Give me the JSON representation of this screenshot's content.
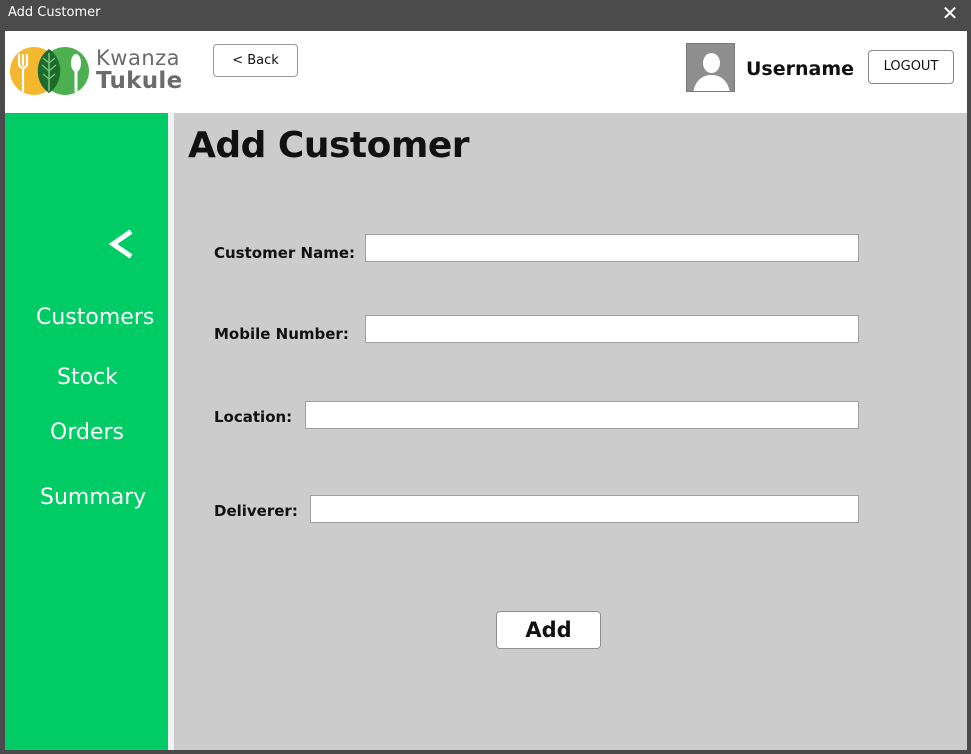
{
  "window": {
    "title": "Add Customer",
    "close_glyph": "✕"
  },
  "header": {
    "brand_line1": "Kwanza",
    "brand_line2": "Tukule",
    "back_label": "< Back",
    "username": "Username",
    "logout_label": "LOGOUT"
  },
  "sidebar": {
    "collapse_icon": "chevron-left-icon",
    "items": [
      {
        "label": "Customers"
      },
      {
        "label": "Stock"
      },
      {
        "label": "Orders"
      },
      {
        "label": "Summary"
      }
    ]
  },
  "form": {
    "title": "Add Customer",
    "fields": [
      {
        "label": "Customer Name:",
        "value": ""
      },
      {
        "label": "Mobile Number:",
        "value": ""
      },
      {
        "label": "Location:",
        "value": ""
      },
      {
        "label": "Deliverer:",
        "value": ""
      }
    ],
    "submit_label": "Add"
  },
  "colors": {
    "sidebar_green": "#00cc66",
    "content_gray": "#cccccc",
    "titlebar": "#4b4b4b",
    "logo_orange": "#f5a623",
    "logo_green": "#4caf50"
  }
}
